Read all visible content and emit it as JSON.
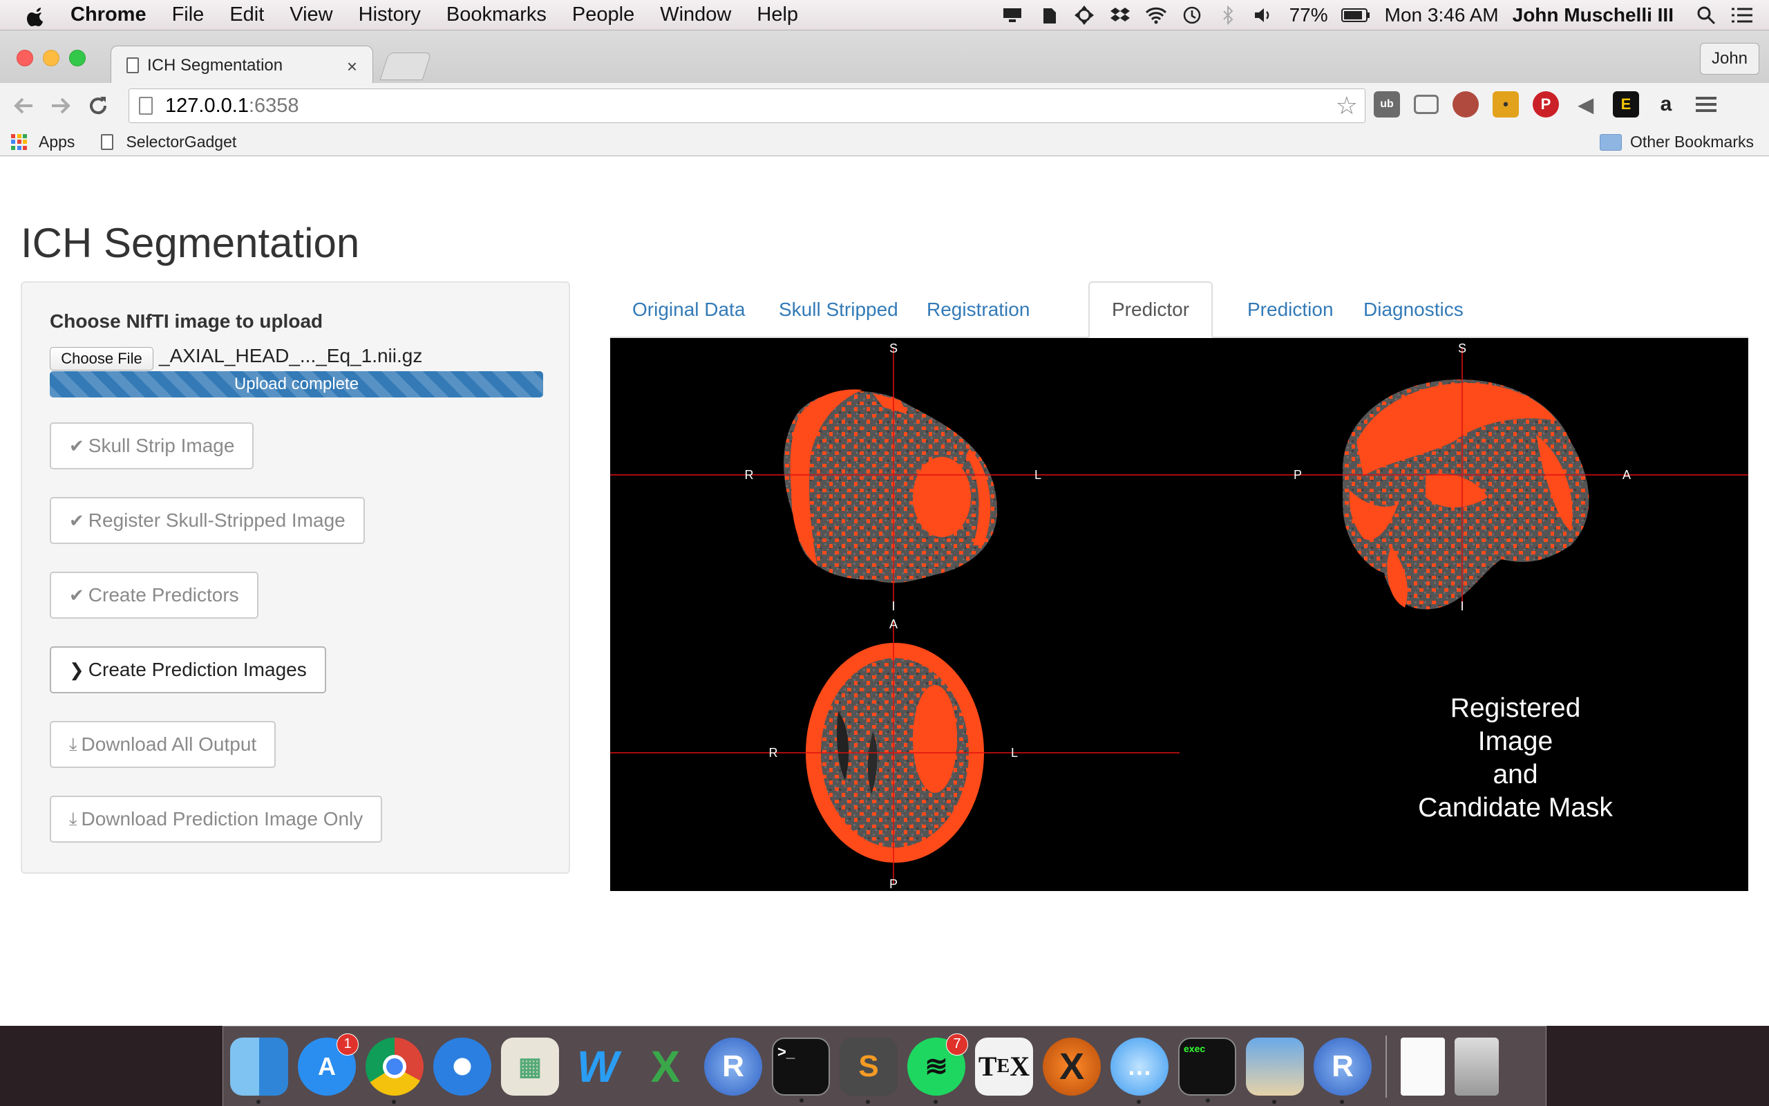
{
  "menubar": {
    "app": "Chrome",
    "menus": [
      "File",
      "Edit",
      "View",
      "History",
      "Bookmarks",
      "People",
      "Window",
      "Help"
    ],
    "battery": "77%",
    "clock": "Mon 3:46 AM",
    "user": "John Muschelli III"
  },
  "browser": {
    "tab_title": "ICH Segmentation",
    "tab_close": "×",
    "profile": "John",
    "url_host": "127.0.0.1",
    "url_port": ":6358",
    "bookmarks": [
      "Apps",
      "SelectorGadget"
    ],
    "other_bookmarks": "Other Bookmarks"
  },
  "page": {
    "title": "ICH Segmentation",
    "upload": {
      "label": "Choose NIfTI image to upload",
      "button": "Choose File",
      "file_name": "_AXIAL_HEAD_..._Eq_1.nii.gz",
      "progress_text": "Upload complete",
      "progress": 1.0
    },
    "buttons": [
      {
        "icon": "check-icon",
        "label": "Skull Strip Image"
      },
      {
        "icon": "check-icon",
        "label": "Register Skull-Stripped Image"
      },
      {
        "icon": "check-icon",
        "label": "Create Predictors"
      },
      {
        "icon": "chevron-right-icon",
        "label": "Create Prediction Images"
      },
      {
        "icon": "download-icon",
        "label": "Download All Output"
      },
      {
        "icon": "download-icon",
        "label": "Download Prediction Image Only"
      }
    ],
    "tabs": [
      "Original Data",
      "Skull Stripped",
      "Registration",
      "Predictor",
      "Prediction",
      "Diagnostics"
    ],
    "active_tab": "Predictor",
    "viewer": {
      "orientation": {
        "coronal": {
          "top": "S",
          "bottom": "I",
          "left": "R",
          "right": "L"
        },
        "sagittal": {
          "top": "S",
          "bottom": "I",
          "left": "P",
          "right": "A"
        },
        "axial": {
          "top": "A",
          "bottom": "P",
          "left": "R",
          "right": "L"
        }
      },
      "caption": [
        "Registered",
        "Image",
        "and",
        "Candidate Mask"
      ]
    }
  },
  "dock": {
    "badges": {
      "app_store": "1",
      "spotify": "7"
    }
  },
  "colors": {
    "link": "#337ab7",
    "progress": "#337ab7",
    "mask": "#ff4a1a",
    "crosshair": "#e01010"
  }
}
